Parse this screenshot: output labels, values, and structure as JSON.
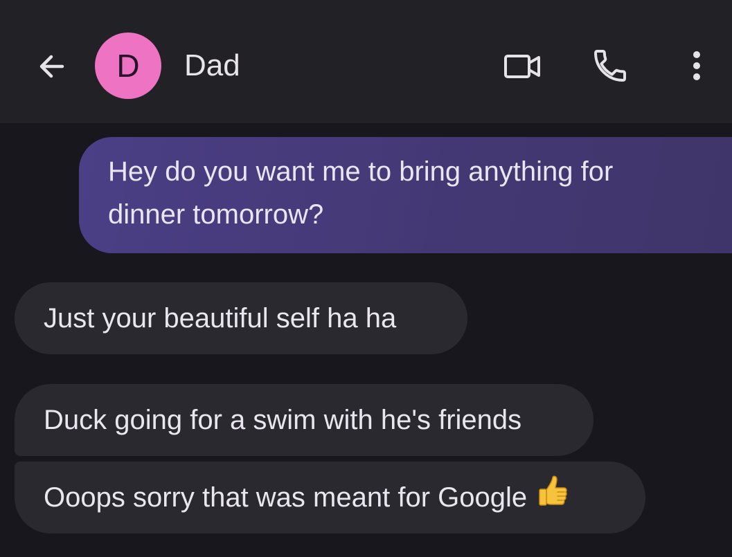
{
  "header": {
    "back_icon": "arrow-left-icon",
    "avatar_initial": "D",
    "avatar_color": "#ee73c2",
    "contact_name": "Dad",
    "video_icon": "video-call-icon",
    "phone_icon": "phone-icon",
    "more_icon": "more-vertical-icon"
  },
  "messages": [
    {
      "direction": "outgoing",
      "text": "Hey do you want me to bring anything for dinner tomorrow?"
    },
    {
      "direction": "incoming",
      "text": "Just your beautiful self ha ha"
    },
    {
      "direction": "incoming",
      "text": "Duck going for a swim with he's friends"
    },
    {
      "direction": "incoming",
      "text": "Ooops sorry that was meant for Google",
      "emoji": "thumbs-up-icon"
    }
  ],
  "colors": {
    "background": "#18171d",
    "header": "#222126",
    "outgoing_bubble": "#463a7c",
    "incoming_bubble": "#2a292f"
  }
}
